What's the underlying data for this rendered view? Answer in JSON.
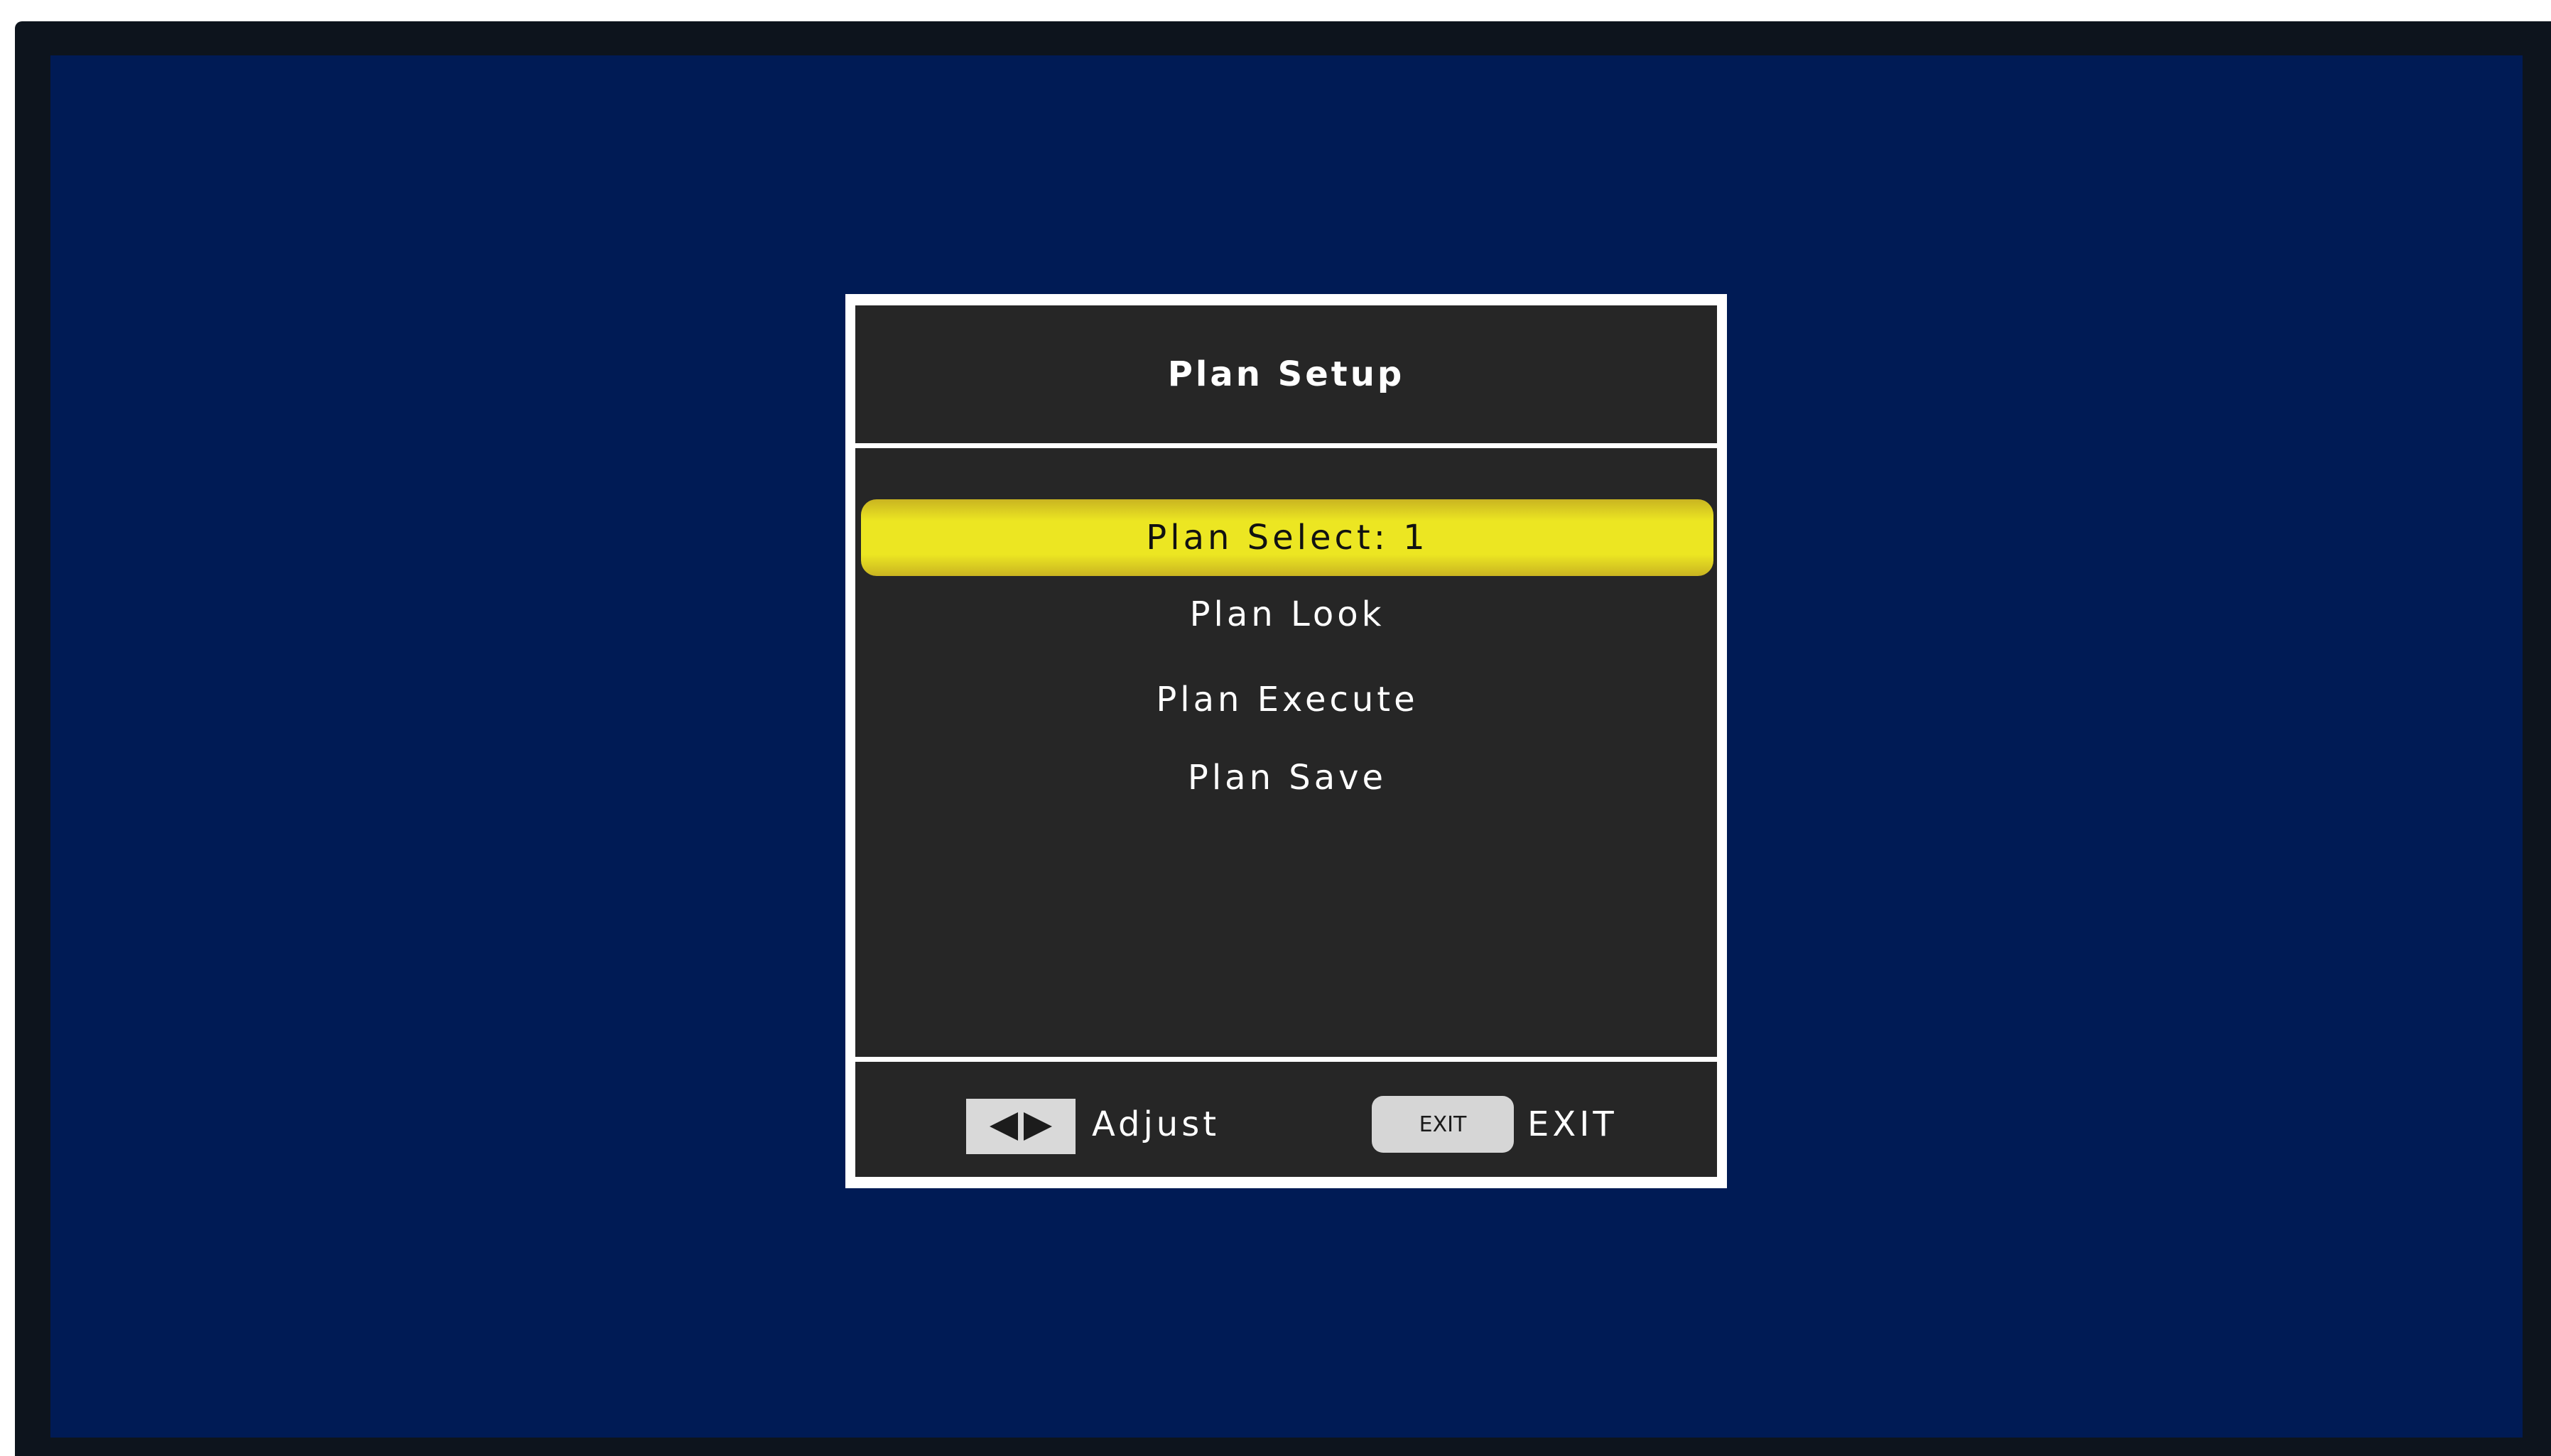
{
  "menu": {
    "title": "Plan Setup",
    "items": [
      {
        "label": "Plan Select: 1",
        "selected": true
      },
      {
        "label": "Plan Look",
        "selected": false
      },
      {
        "label": "Plan Execute",
        "selected": false
      },
      {
        "label": "Plan Save",
        "selected": false
      }
    ]
  },
  "footer": {
    "adjust_icon": "left-right-arrows-icon",
    "adjust_label": "Adjust",
    "exit_key_label": "EXIT",
    "exit_label": "EXIT"
  },
  "colors": {
    "screen_background": "#001b55",
    "menu_background": "#262626",
    "highlight": "#ece622",
    "frame": "#ffffff"
  }
}
